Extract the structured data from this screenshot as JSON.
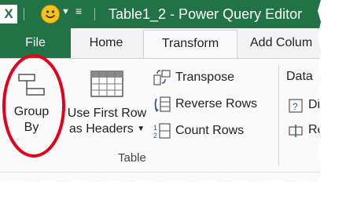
{
  "titlebar": {
    "app_logo": "X",
    "window_title": "Table1_2 - Power Query Editor",
    "icons": [
      "excel-logo",
      "smiley-feedback-icon",
      "chevron-down-icon",
      "customize-toolbar-icon"
    ]
  },
  "tabs": [
    {
      "label": "File"
    },
    {
      "label": "Home"
    },
    {
      "label": "Transform",
      "active": true
    },
    {
      "label": "Add Colum"
    }
  ],
  "ribbon": {
    "group_by": {
      "line1": "Group",
      "line2": "By"
    },
    "use_first_row": {
      "line1": "Use First Row",
      "line2": "as Headers"
    },
    "transpose": "Transpose",
    "reverse_rows": "Reverse Rows",
    "count_rows": "Count Rows",
    "group_label": "Table",
    "data_group_label": "Data",
    "right_items": [
      "Di",
      "Re"
    ]
  },
  "colors": {
    "excel_green": "#217346",
    "highlight_red": "#e2001a"
  }
}
